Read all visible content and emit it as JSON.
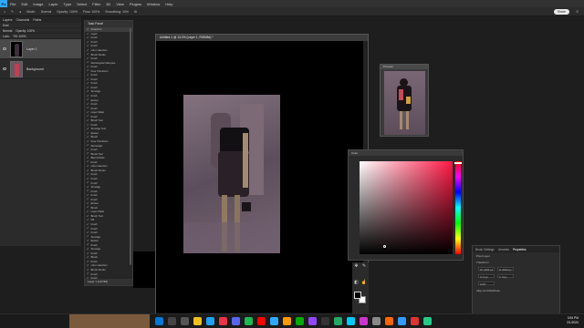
{
  "menubar": {
    "logo": "Ps",
    "items": [
      "File",
      "Edit",
      "Image",
      "Layer",
      "Type",
      "Select",
      "Filter",
      "3D",
      "View",
      "Plugins",
      "Window",
      "Help"
    ]
  },
  "optbar": {
    "mode": "Mode:",
    "normal": "Normal",
    "opacity": "Opacity: 100%",
    "flow": "Flow: 100%",
    "smoothing": "Smoothing: 10%",
    "share": "Share"
  },
  "layers": {
    "tabs": [
      "Layers",
      "Channels",
      "Paths"
    ],
    "kind": "Kind",
    "blend": "Normal",
    "opacity": "Opacity: 100%",
    "lock": "Lock:",
    "fill": "Fill: 100%",
    "items": [
      {
        "name": "Layer 1"
      },
      {
        "name": "Background"
      }
    ]
  },
  "tasks": {
    "title": "Task Panel",
    "items": [
      "Snapshot",
      "Layer",
      "brush",
      "brush",
      "brush",
      "color selection",
      "Brush Stroke",
      "brush",
      "Rectangular Marquee",
      "brush",
      "Free Transform",
      "brush",
      "brush",
      "brush",
      "brush",
      "Smudge",
      "brush",
      "Eraser",
      "brush",
      "brush",
      "Layer Mask",
      "brush",
      "Brush Tool",
      "brush",
      "Smudge Tool",
      "Eraser",
      "Brush",
      "Free Transform",
      "Rectangle",
      "brush",
      "Brush Tool",
      "Blend Mode",
      "brush",
      "color selection",
      "Brush Stroke",
      "brush",
      "brush",
      "brush",
      "Smudge",
      "brush",
      "brush",
      "brush",
      "Eraser",
      "Brush",
      "Layer Mask",
      "Brush Tool",
      "Fill",
      "brush",
      "brush",
      "brush",
      "Smudge",
      "Eraser",
      "brush",
      "Smudge",
      "brush",
      "Brush",
      "brush",
      "color selection",
      "Brush Stroke",
      "brush",
      "brush"
    ],
    "footer": "Layer 1 (14/768)"
  },
  "document": {
    "tab": "Untitled-1 @ 13.2% (Layer 1, RGB/8#) *"
  },
  "preview": {
    "title": "Preview"
  },
  "picker": {
    "title": "Color",
    "fg": "#000000",
    "bg": "#ffffff",
    "hue_color": "#ff1744"
  },
  "props": {
    "tabs": [
      "Brush Settings",
      "Libraries",
      "Properties"
    ],
    "section1": "Pixel Layer",
    "section2": "Transform",
    "w": "W: 2332 px",
    "h": "H: 3612 px",
    "x": "X: 0 px",
    "y": "Y: 0 px",
    "angle": "0.00°",
    "section3": "Align and Distribute"
  },
  "taskbar": {
    "time": "3:54 PM",
    "date": "2/1/2024"
  },
  "colors": {
    "accent": "#31a8ff"
  }
}
